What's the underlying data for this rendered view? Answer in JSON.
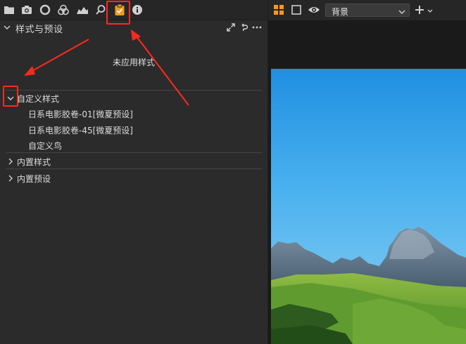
{
  "toolbar": {
    "icons": [
      "folder-icon",
      "camera-icon",
      "circle-icon",
      "color-balance-icon",
      "histogram-icon",
      "search-icon",
      "clipboard-check-icon",
      "info-icon"
    ],
    "active_icon": "clipboard-check-icon",
    "accent_color": "#f29b1d"
  },
  "styles_panel": {
    "title": "样式与预设",
    "empty_message": "未应用样式",
    "groups": [
      {
        "label": "自定义样式",
        "expanded": true,
        "items": [
          "日系电影胶卷-01[微夏预设]",
          "日系电影胶卷-45[微夏预设]",
          "自定义鸟"
        ]
      },
      {
        "label": "内置样式",
        "expanded": false
      },
      {
        "label": "内置预设",
        "expanded": false
      }
    ]
  },
  "viewer_toolbar": {
    "layer_select_value": "背景"
  },
  "annotation_color": "#ff2a1e"
}
